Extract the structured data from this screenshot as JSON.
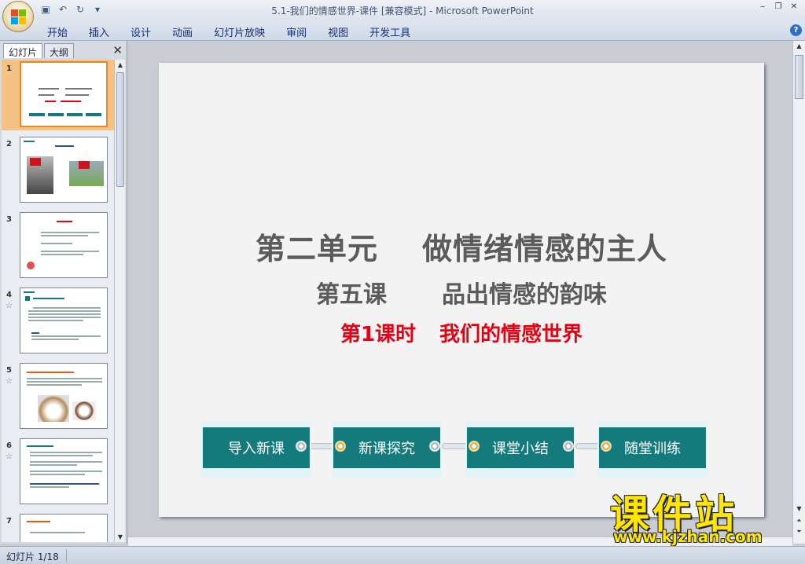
{
  "window": {
    "title": "5.1-我们的情感世界-课件 [兼容模式] - Microsoft PowerPoint",
    "controls": [
      "‒",
      "❐",
      "✕"
    ]
  },
  "quick_access": {
    "icons": [
      "save-icon",
      "undo-icon",
      "redo-icon",
      "customize-icon"
    ],
    "glyphs": [
      "▣",
      "↶",
      "↻",
      "▾"
    ]
  },
  "ribbon": {
    "tabs": [
      "开始",
      "插入",
      "设计",
      "动画",
      "幻灯片放映",
      "审阅",
      "视图",
      "开发工具"
    ],
    "help": "?"
  },
  "left_pane": {
    "tab_slides": "幻灯片",
    "tab_outline": "大纲",
    "close": "✕",
    "thumbnails": [
      {
        "num": "1",
        "selected": true
      },
      {
        "num": "2",
        "selected": false
      },
      {
        "num": "3",
        "selected": false
      },
      {
        "num": "4",
        "selected": false,
        "star": "☆"
      },
      {
        "num": "5",
        "selected": false,
        "star": "☆"
      },
      {
        "num": "6",
        "selected": false,
        "star": "☆"
      },
      {
        "num": "7",
        "selected": false
      }
    ]
  },
  "slide": {
    "title_a": "第二单元",
    "title_b": "做情绪情感的主人",
    "subtitle_a": "第五课",
    "subtitle_b": "品出情感的韵味",
    "lesson_a": "第1课时",
    "lesson_b": "我们的情感世界",
    "nav_buttons": [
      "导入新课",
      "新课探究",
      "课堂小结",
      "随堂训练"
    ],
    "colors": {
      "teal": "#157a7c",
      "red": "#e60012",
      "gray": "#5b5b5b"
    }
  },
  "watermark": {
    "text": "课件站",
    "url": "www.kjzhan.com"
  },
  "status": {
    "slide_indicator": "幻灯片 1/18"
  }
}
